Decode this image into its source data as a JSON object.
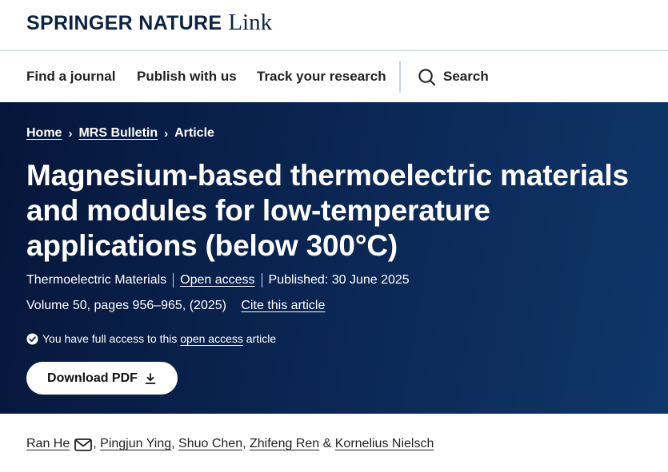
{
  "header": {
    "brand_main": "SPRINGER NATURE",
    "brand_link": "Link"
  },
  "nav": {
    "items": [
      "Find a journal",
      "Publish with us",
      "Track your research"
    ],
    "search_label": "Search"
  },
  "breadcrumb": {
    "home": "Home",
    "journal": "MRS Bulletin",
    "current": "Article",
    "separator": "›"
  },
  "article": {
    "title": "Magnesium-based thermoelectric materials and modules for low-temperature applications (below 300°C)",
    "section": "Thermoelectric Materials",
    "open_access": "Open access",
    "published": "Published: 30 June 2025",
    "volume": "Volume 50, pages 956–965, (2025)",
    "cite": "Cite this article",
    "access_prefix": "You have full access to this",
    "access_link": "open access",
    "access_suffix": "article",
    "download_label": "Download PDF"
  },
  "authors": {
    "list": [
      "Ran He",
      "Pingjun Ying",
      "Shuo Chen",
      "Zhifeng Ren",
      "Kornelius Nielsch"
    ],
    "comma": ",",
    "ampersand": "&"
  },
  "colors": {
    "hero_start": "#06163a",
    "hero_end": "#0f3669",
    "brand": "#0c2340"
  },
  "icons": [
    "search-icon",
    "chevron-right-icon",
    "check-circle-icon",
    "download-icon",
    "mail-icon"
  ]
}
